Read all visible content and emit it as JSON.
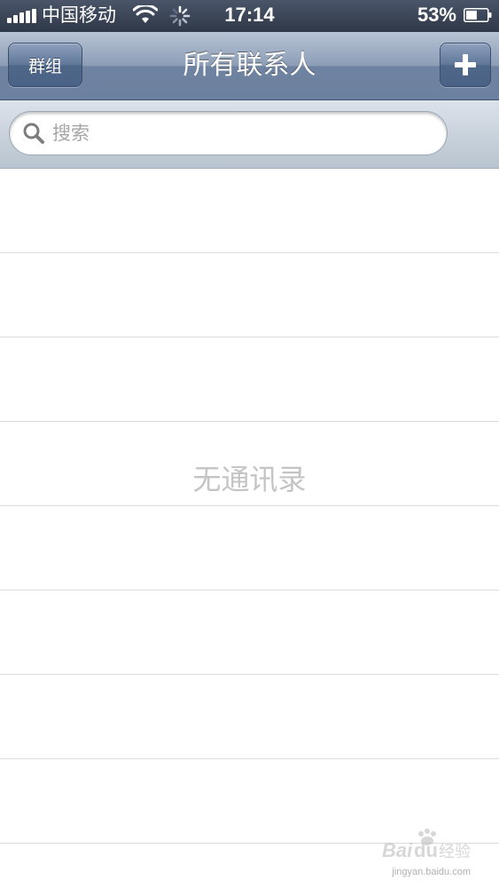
{
  "status_bar": {
    "carrier": "中国移动",
    "time": "17:14",
    "battery_percent": "53%",
    "battery_level": 0.53
  },
  "nav": {
    "title": "所有联系人",
    "groups_label": "群组",
    "add_label": "+"
  },
  "search": {
    "placeholder": "搜索"
  },
  "list": {
    "empty_text": "无通讯录"
  },
  "watermark": {
    "text": "Baidu经验",
    "url": "jingyan.baidu.com"
  }
}
